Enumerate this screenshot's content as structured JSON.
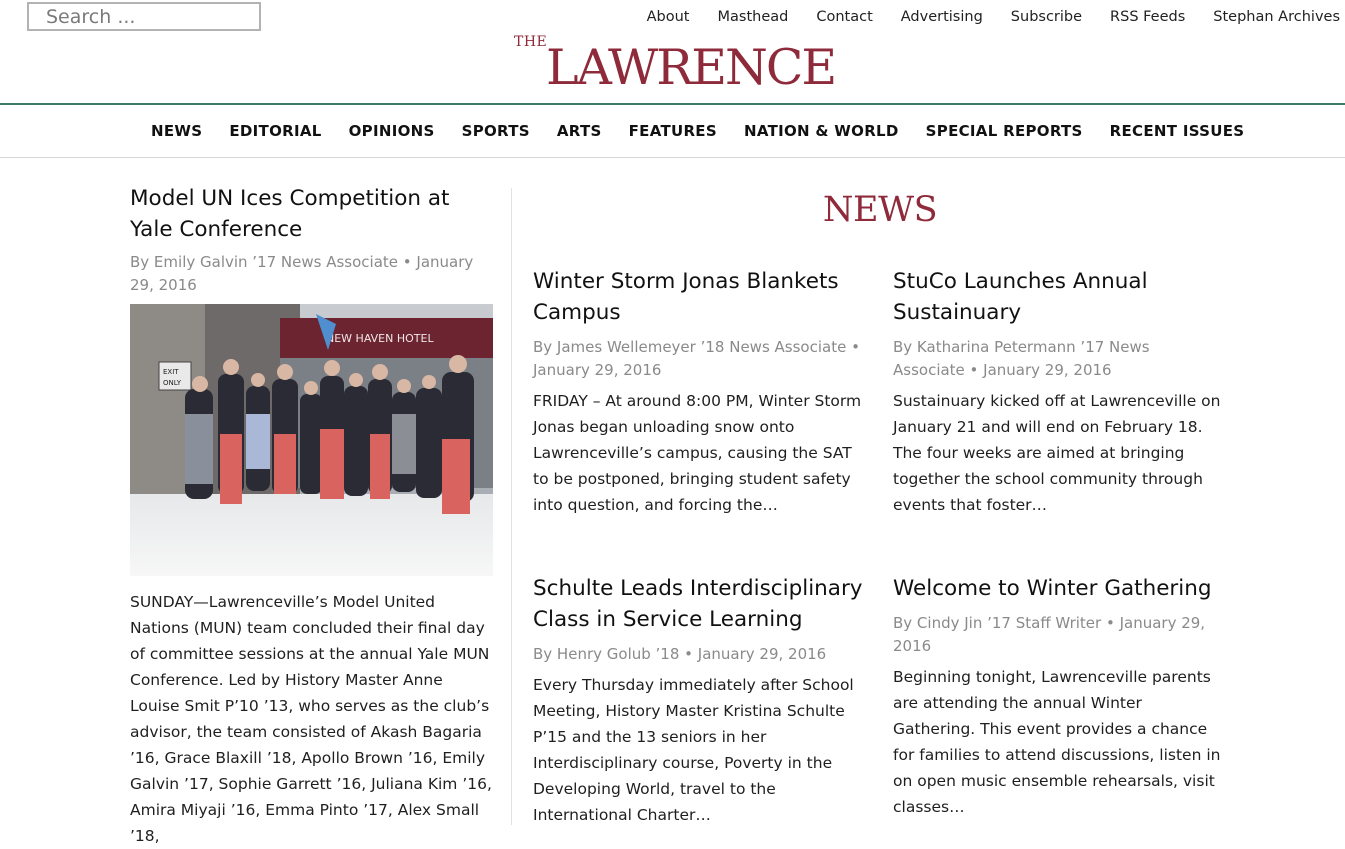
{
  "search": {
    "placeholder": "Search ..."
  },
  "top_links": [
    "About",
    "Masthead",
    "Contact",
    "Advertising",
    "Subscribe",
    "RSS Feeds",
    "Stephan Archives"
  ],
  "logo": {
    "the": "THE",
    "name": "LAWRENCE"
  },
  "nav": [
    "NEWS",
    "EDITORIAL",
    "OPINIONS",
    "SPORTS",
    "ARTS",
    "FEATURES",
    "NATION & WORLD",
    "SPECIAL REPORTS",
    "RECENT ISSUES"
  ],
  "featured": {
    "headline": "Model UN Ices Competition at Yale Conference",
    "byline": "By Emily Galvin ’17 News Associate • January 29, 2016",
    "photo_text": {
      "hotel": "NEW HAVEN HOTEL",
      "exit": "EXIT ONLY"
    },
    "excerpt": "SUNDAY—Lawrenceville’s Model United Nations (MUN) team concluded their final day of committee sessions at the annual Yale MUN Conference. Led by History Master Anne Louise Smit P’10 ’13, who serves as the club’s advisor, the team consisted of Akash Bagaria ’16, Grace Blaxill ’18, Apollo Brown ’16, Emily Galvin ’17, Sophie Garrett ’16, Juliana Kim ’16, Amira Miyaji ’16, Emma Pinto ’17, Alex Small ’18,"
  },
  "section_title": "NEWS",
  "articles": [
    {
      "headline": "Winter Storm Jonas Blankets Campus",
      "byline": "By James Wellemeyer ’18 News Associate • January 29, 2016",
      "excerpt": "FRIDAY – At around 8:00 PM, Winter Storm Jonas began unloading snow onto Lawrenceville’s campus, causing the SAT to be postponed, bringing student safety into question, and forcing the…"
    },
    {
      "headline": "StuCo Launches Annual Sustainuary",
      "byline": "By Katharina Petermann ’17 News Associate • January 29, 2016",
      "excerpt": "Sustainuary kicked off at Lawrenceville on January 21 and will end on February 18. The four weeks are aimed at bringing together the school community through events that foster…"
    },
    {
      "headline": "Schulte Leads Interdisciplinary Class in Service Learning",
      "byline": "By Henry Golub ’18 • January 29, 2016",
      "excerpt": "Every Thursday immediately after School Meeting, History Master Kristina Schulte P’15 and the 13 seniors in her Interdisciplinary course, Poverty in the Developing World,  travel to the International Charter…"
    },
    {
      "headline": "Welcome to Winter Gathering",
      "byline": "By Cindy Jin ’17 Staff Writer • January 29, 2016",
      "excerpt": "Beginning tonight, Lawrenceville parents are attending the annual Winter Gathering. This event provides a chance for families to attend discussions, listen in on open music ensemble rehearsals, visit classes…"
    }
  ],
  "colors": {
    "brand": "#8e2a3a",
    "rule": "#3d7a6a",
    "byline": "#8a8a8a"
  }
}
